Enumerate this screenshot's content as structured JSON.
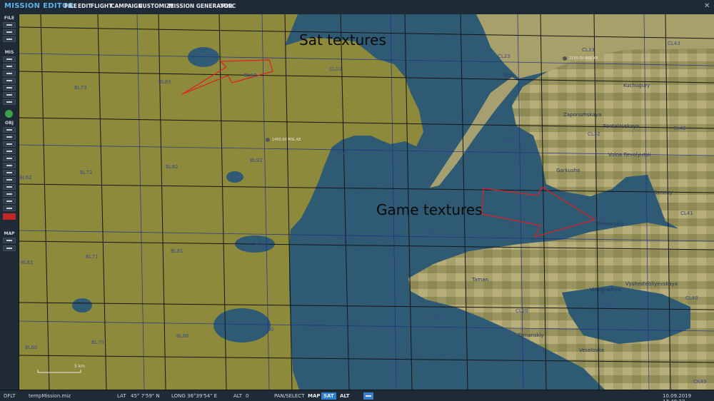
{
  "app": {
    "title": "MISSION EDITOR",
    "close_glyph": "✕"
  },
  "menu": [
    {
      "label": "FILE"
    },
    {
      "label": "EDIT"
    },
    {
      "label": "FLIGHT"
    },
    {
      "label": "CAMPAIGN"
    },
    {
      "label": "CUSTOMIZE"
    },
    {
      "label": "MISSION GENERATOR"
    },
    {
      "label": "MISC"
    }
  ],
  "sidebar": {
    "sections": {
      "file": "FILE",
      "mis": "MIS",
      "obj": "OBJ",
      "map": "MAP"
    }
  },
  "map": {
    "annotations": {
      "sat": "Sat textures",
      "game": "Game textures"
    },
    "grid_labels": [
      "BL73",
      "BL83",
      "BL93",
      "CL03",
      "CL13",
      "CL23",
      "CL33",
      "CL43",
      "BL82",
      "BL92",
      "CL02",
      "CL12",
      "CL22",
      "CL32",
      "CL42",
      "BL72",
      "BL62",
      "CL41",
      "BL71",
      "BL81",
      "BL91",
      "CL01",
      "CL11",
      "CL21",
      "CL31",
      "BL61",
      "BL70",
      "BL80",
      "BL90",
      "CL00",
      "CL10",
      "CL20",
      "CL30",
      "CL40",
      "BL60",
      "CK49"
    ],
    "place_labels": [
      "Ilich",
      "Kuchugury",
      "Zaporozhskaya",
      "Fontalovskaya",
      "Volna Revolyutsii",
      "Garkusha",
      "Sennoy",
      "Taman",
      "Vinogradnyy",
      "Vyshestebliyevskaya",
      "Tamanskiy",
      "Veselovka",
      "Primorskiy"
    ],
    "altitude_marks": [
      "1450.00 MSL KE",
      "2150.00 MSL KE"
    ],
    "scale_label": "5 km",
    "colors": {
      "water": "#2f5a73",
      "land": "#8a8a3a",
      "grid_major": "#141414",
      "grid_minor": "#1c2f8c",
      "arrow": "#e02020"
    }
  },
  "status": {
    "profile": "DFLT",
    "file": "tempMission.miz",
    "lat_label": "LAT",
    "lat_value": "45° 7'59\" N",
    "long_label": "LONG",
    "long_value": "36°39'54\" E",
    "alt_label": "ALT",
    "alt_value": "0",
    "mode": "PAN/SELECT",
    "btn_map": "MAP",
    "btn_sat": "SAT",
    "btn_alt": "ALT",
    "datetime": "10.09.2019 17:49:23"
  }
}
